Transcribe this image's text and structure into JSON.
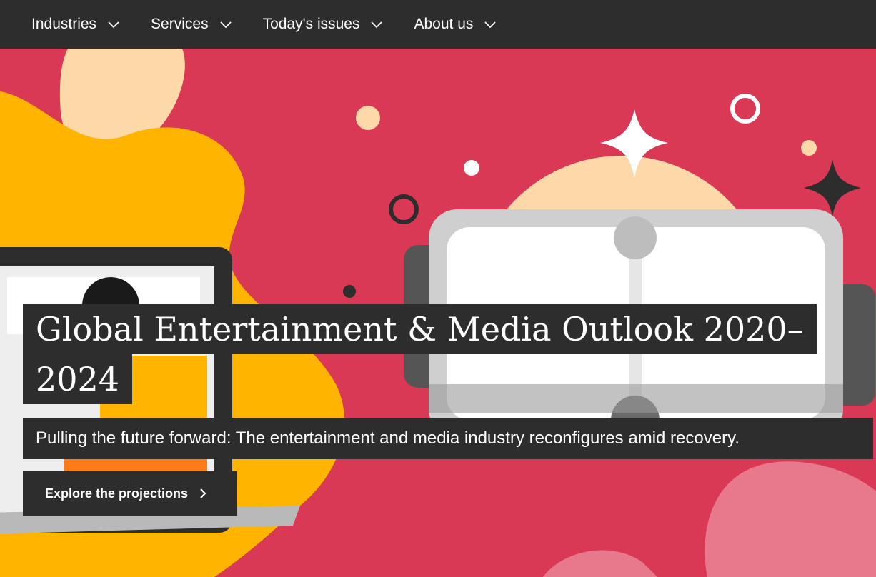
{
  "nav": {
    "items": [
      {
        "label": "Industries"
      },
      {
        "label": "Services"
      },
      {
        "label": "Today's issues"
      },
      {
        "label": "About us"
      }
    ]
  },
  "hero": {
    "title_line1": "Global Entertainment & Media Outlook 2020–",
    "title_line2": "2024",
    "subtitle": "Pulling the future forward: The entertainment and media industry reconfigures amid recovery.",
    "cta_label": "Explore the projections"
  },
  "colors": {
    "background": "#d93954",
    "nav_bg": "#2d2d2d",
    "label_bg": "#2d2d2d",
    "yellow": "#ffb400",
    "peach": "#fdd8a8",
    "text": "#ffffff"
  },
  "icons": {
    "nav_dropdown": "chevron-down-icon",
    "cta_arrow": "chevron-right-icon"
  }
}
